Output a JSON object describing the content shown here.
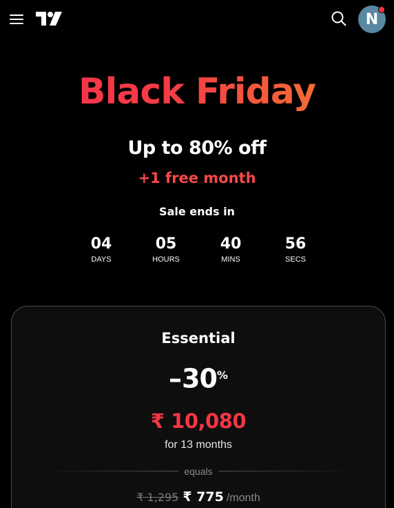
{
  "header": {
    "menu_icon": "hamburger-menu-icon",
    "logo_icon": "tradingview-logo-icon",
    "search_icon": "search-icon",
    "avatar_initial": "N",
    "notification_color": "#f23645"
  },
  "hero": {
    "title": "Black Friday",
    "offer": "Up to 80% off",
    "bonus": "+1 free month",
    "sale_ends_label": "Sale ends in",
    "gradient_colors": [
      "#f7304b",
      "#f7852a"
    ]
  },
  "countdown": [
    {
      "value": "04",
      "label": "DAYS"
    },
    {
      "value": "05",
      "label": "HOURS"
    },
    {
      "value": "40",
      "label": "MINS"
    },
    {
      "value": "56",
      "label": "SECS"
    }
  ],
  "plan": {
    "name": "Essential",
    "discount_sign": "–",
    "discount_value": "30",
    "discount_unit": "%",
    "price": "₹ 10,080",
    "period": "for 13 months",
    "equals_label": "equals",
    "old_monthly_price": "₹ 1,295",
    "new_monthly_price": "₹ 775",
    "per_month_label": "/month",
    "price_color": "#f23645"
  }
}
